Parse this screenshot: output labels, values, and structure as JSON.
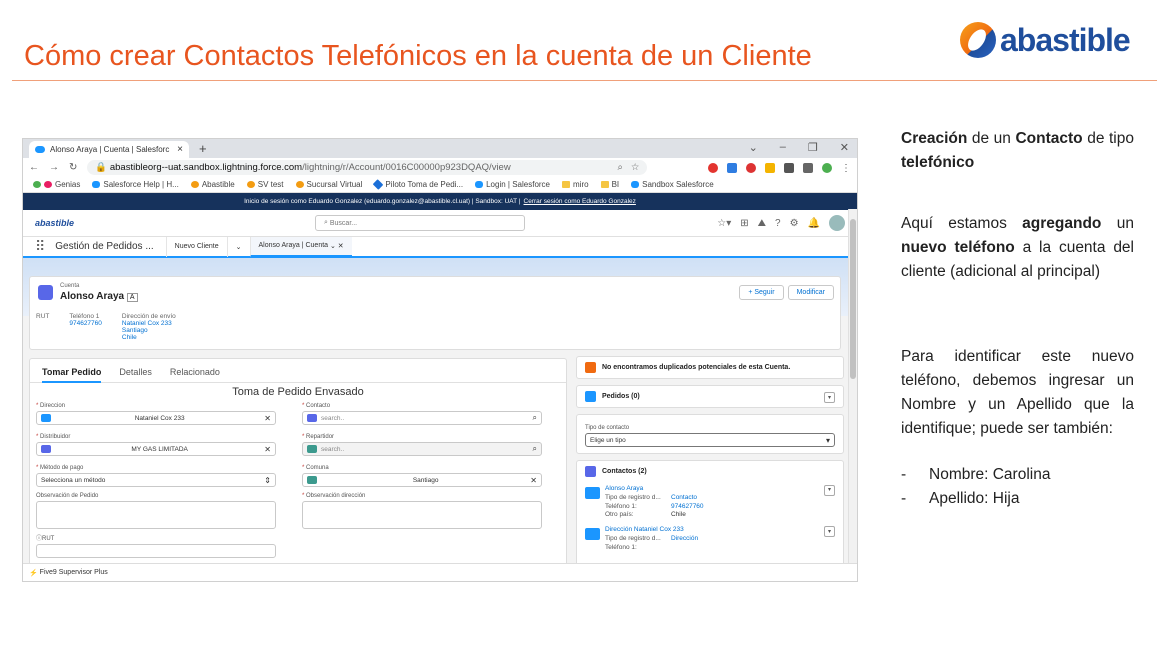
{
  "slide": {
    "title": "Cómo crear Contactos Telefónicos en la cuenta de un Cliente",
    "logo_text": "abastible",
    "title_color": "#e8551f",
    "logo_color": "#1f4e9c"
  },
  "browser": {
    "tab_title": "Alonso Araya | Cuenta | Salesforc",
    "url_domain": "abastibleorg--uat.sandbox.lightning.force.com",
    "url_path": "/lightning/r/Account/0016C00000p923DQAQ/view",
    "bookmarks": [
      "Genias",
      "Salesforce Help | H...",
      "Abastible",
      "SV test",
      "Sucursal Virtual",
      "Piloto Toma de Pedi...",
      "Login | Salesforce",
      "miro",
      "BI",
      "Sandbox Salesforce"
    ]
  },
  "sf": {
    "banner_text": "Inicio de sesión como Eduardo Gonzalez (eduardo.gonzalez@abastible.cl.uat) | Sandbox: UAT |",
    "banner_link": "Cerrar sesión como Eduardo Gonzalez",
    "logo": "abastible",
    "search_placeholder": "Buscar...",
    "app_name": "Gestión de Pedidos ...",
    "nav_tab_1": "Nuevo Cliente",
    "nav_tab_2": "Alonso Araya | Cuenta",
    "record_type": "Cuenta",
    "record_name": "Alonso Araya",
    "btn_follow": "+ Seguir",
    "btn_edit": "Modificar",
    "f_rut_label": "RUT",
    "f_phone_label": "Teléfono 1",
    "f_phone_value": "974627760",
    "f_addr_label": "Dirección de envío",
    "f_addr_1": "Nataniel Cox 233",
    "f_addr_2": "Santiago",
    "f_addr_3": "Chile",
    "tabs": [
      "Tomar Pedido",
      "Detalles",
      "Relacionado"
    ],
    "form_title": "Toma de Pedido Envasado",
    "lbl_direccion": "Direccion",
    "val_direccion": "Nataniel Cox 233",
    "lbl_distribuidor": "Distribuidor",
    "val_distribuidor": "MY GAS LIMITADA",
    "lbl_pago": "Método de pago",
    "val_pago": "Selecciona un método",
    "lbl_obs": "Observación de Pedido",
    "lbl_rut": "RUT",
    "lbl_contacto": "Contacto",
    "ph_contacto": "search..",
    "lbl_repartidor": "Repartidor",
    "ph_repartidor": "search..",
    "lbl_comuna": "Comuna",
    "val_comuna": "Santiago",
    "lbl_obs_dir": "Observación dirección",
    "dup_msg": "No encontramos duplicados potenciales de esta Cuenta.",
    "pedidos": "Pedidos (0)",
    "tipo_label": "Tipo de contacto",
    "tipo_value": "Elige un tipo",
    "contactos": "Contactos (2)",
    "c1_name": "Alonso Araya",
    "c1_k1": "Tipo de registro d...",
    "c1_v1": "Contacto",
    "c1_k2": "Teléfono 1:",
    "c1_v2": "974627760",
    "c1_k3": "Otro país:",
    "c1_v3": "Chile",
    "c2_name": "Dirección Nataniel Cox 233",
    "c2_k1": "Tipo de registro d...",
    "c2_v1": "Dirección",
    "c2_k2": "Teléfono 1:",
    "status_bar": "Five9 Supervisor Plus"
  },
  "notes": {
    "p1_a": "Creación",
    "p1_b": " de un ",
    "p1_c": "Contacto",
    "p1_d": " de tipo ",
    "p1_e": "telefónico",
    "p2_a": "Aquí estamos ",
    "p2_b": "agregando",
    "p2_c": " un ",
    "p2_d": "nuevo teléfono",
    "p2_e": " a la cuenta del cliente (adicional al principal)",
    "p3": "Para identificar este nuevo teléfono, debemos ingresar un Nombre y un Apellido que la identifique; puede ser también:",
    "bullet_1": "Nombre: Carolina",
    "bullet_2": "Apellido: Hija"
  }
}
